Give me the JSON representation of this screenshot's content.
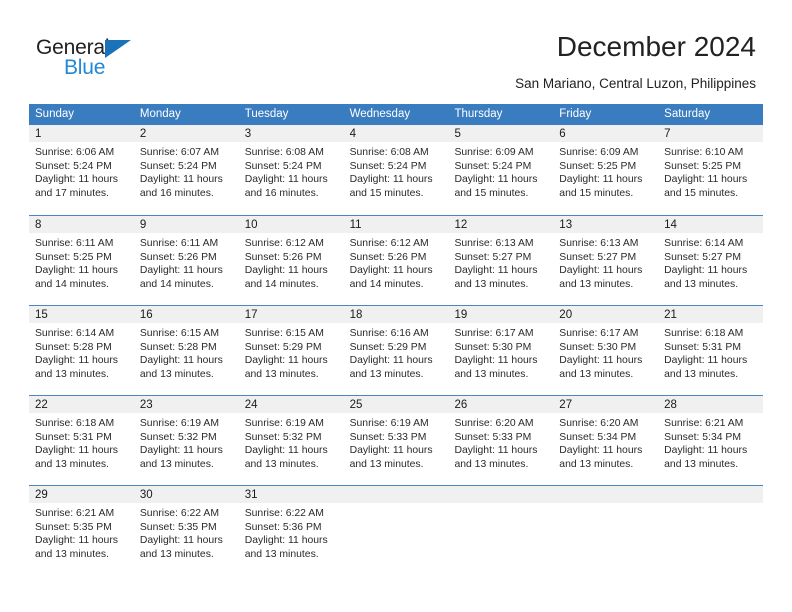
{
  "logo": {
    "word1": "General",
    "word2": "Blue",
    "triangle_color": "#1b72b8",
    "word2_color": "#2288d6"
  },
  "header": {
    "title": "December 2024",
    "subtitle": "San Mariano, Central Luzon, Philippines"
  },
  "calendar": {
    "header_bg": "#3a7cc0",
    "daynum_bg": "#f0f0f0",
    "weekdays": [
      "Sunday",
      "Monday",
      "Tuesday",
      "Wednesday",
      "Thursday",
      "Friday",
      "Saturday"
    ],
    "weeks": [
      [
        {
          "day": "1",
          "sunrise": "Sunrise: 6:06 AM",
          "sunset": "Sunset: 5:24 PM",
          "daylight_line1": "Daylight: 11 hours",
          "daylight_line2": "and 17 minutes."
        },
        {
          "day": "2",
          "sunrise": "Sunrise: 6:07 AM",
          "sunset": "Sunset: 5:24 PM",
          "daylight_line1": "Daylight: 11 hours",
          "daylight_line2": "and 16 minutes."
        },
        {
          "day": "3",
          "sunrise": "Sunrise: 6:08 AM",
          "sunset": "Sunset: 5:24 PM",
          "daylight_line1": "Daylight: 11 hours",
          "daylight_line2": "and 16 minutes."
        },
        {
          "day": "4",
          "sunrise": "Sunrise: 6:08 AM",
          "sunset": "Sunset: 5:24 PM",
          "daylight_line1": "Daylight: 11 hours",
          "daylight_line2": "and 15 minutes."
        },
        {
          "day": "5",
          "sunrise": "Sunrise: 6:09 AM",
          "sunset": "Sunset: 5:24 PM",
          "daylight_line1": "Daylight: 11 hours",
          "daylight_line2": "and 15 minutes."
        },
        {
          "day": "6",
          "sunrise": "Sunrise: 6:09 AM",
          "sunset": "Sunset: 5:25 PM",
          "daylight_line1": "Daylight: 11 hours",
          "daylight_line2": "and 15 minutes."
        },
        {
          "day": "7",
          "sunrise": "Sunrise: 6:10 AM",
          "sunset": "Sunset: 5:25 PM",
          "daylight_line1": "Daylight: 11 hours",
          "daylight_line2": "and 15 minutes."
        }
      ],
      [
        {
          "day": "8",
          "sunrise": "Sunrise: 6:11 AM",
          "sunset": "Sunset: 5:25 PM",
          "daylight_line1": "Daylight: 11 hours",
          "daylight_line2": "and 14 minutes."
        },
        {
          "day": "9",
          "sunrise": "Sunrise: 6:11 AM",
          "sunset": "Sunset: 5:26 PM",
          "daylight_line1": "Daylight: 11 hours",
          "daylight_line2": "and 14 minutes."
        },
        {
          "day": "10",
          "sunrise": "Sunrise: 6:12 AM",
          "sunset": "Sunset: 5:26 PM",
          "daylight_line1": "Daylight: 11 hours",
          "daylight_line2": "and 14 minutes."
        },
        {
          "day": "11",
          "sunrise": "Sunrise: 6:12 AM",
          "sunset": "Sunset: 5:26 PM",
          "daylight_line1": "Daylight: 11 hours",
          "daylight_line2": "and 14 minutes."
        },
        {
          "day": "12",
          "sunrise": "Sunrise: 6:13 AM",
          "sunset": "Sunset: 5:27 PM",
          "daylight_line1": "Daylight: 11 hours",
          "daylight_line2": "and 13 minutes."
        },
        {
          "day": "13",
          "sunrise": "Sunrise: 6:13 AM",
          "sunset": "Sunset: 5:27 PM",
          "daylight_line1": "Daylight: 11 hours",
          "daylight_line2": "and 13 minutes."
        },
        {
          "day": "14",
          "sunrise": "Sunrise: 6:14 AM",
          "sunset": "Sunset: 5:27 PM",
          "daylight_line1": "Daylight: 11 hours",
          "daylight_line2": "and 13 minutes."
        }
      ],
      [
        {
          "day": "15",
          "sunrise": "Sunrise: 6:14 AM",
          "sunset": "Sunset: 5:28 PM",
          "daylight_line1": "Daylight: 11 hours",
          "daylight_line2": "and 13 minutes."
        },
        {
          "day": "16",
          "sunrise": "Sunrise: 6:15 AM",
          "sunset": "Sunset: 5:28 PM",
          "daylight_line1": "Daylight: 11 hours",
          "daylight_line2": "and 13 minutes."
        },
        {
          "day": "17",
          "sunrise": "Sunrise: 6:15 AM",
          "sunset": "Sunset: 5:29 PM",
          "daylight_line1": "Daylight: 11 hours",
          "daylight_line2": "and 13 minutes."
        },
        {
          "day": "18",
          "sunrise": "Sunrise: 6:16 AM",
          "sunset": "Sunset: 5:29 PM",
          "daylight_line1": "Daylight: 11 hours",
          "daylight_line2": "and 13 minutes."
        },
        {
          "day": "19",
          "sunrise": "Sunrise: 6:17 AM",
          "sunset": "Sunset: 5:30 PM",
          "daylight_line1": "Daylight: 11 hours",
          "daylight_line2": "and 13 minutes."
        },
        {
          "day": "20",
          "sunrise": "Sunrise: 6:17 AM",
          "sunset": "Sunset: 5:30 PM",
          "daylight_line1": "Daylight: 11 hours",
          "daylight_line2": "and 13 minutes."
        },
        {
          "day": "21",
          "sunrise": "Sunrise: 6:18 AM",
          "sunset": "Sunset: 5:31 PM",
          "daylight_line1": "Daylight: 11 hours",
          "daylight_line2": "and 13 minutes."
        }
      ],
      [
        {
          "day": "22",
          "sunrise": "Sunrise: 6:18 AM",
          "sunset": "Sunset: 5:31 PM",
          "daylight_line1": "Daylight: 11 hours",
          "daylight_line2": "and 13 minutes."
        },
        {
          "day": "23",
          "sunrise": "Sunrise: 6:19 AM",
          "sunset": "Sunset: 5:32 PM",
          "daylight_line1": "Daylight: 11 hours",
          "daylight_line2": "and 13 minutes."
        },
        {
          "day": "24",
          "sunrise": "Sunrise: 6:19 AM",
          "sunset": "Sunset: 5:32 PM",
          "daylight_line1": "Daylight: 11 hours",
          "daylight_line2": "and 13 minutes."
        },
        {
          "day": "25",
          "sunrise": "Sunrise: 6:19 AM",
          "sunset": "Sunset: 5:33 PM",
          "daylight_line1": "Daylight: 11 hours",
          "daylight_line2": "and 13 minutes."
        },
        {
          "day": "26",
          "sunrise": "Sunrise: 6:20 AM",
          "sunset": "Sunset: 5:33 PM",
          "daylight_line1": "Daylight: 11 hours",
          "daylight_line2": "and 13 minutes."
        },
        {
          "day": "27",
          "sunrise": "Sunrise: 6:20 AM",
          "sunset": "Sunset: 5:34 PM",
          "daylight_line1": "Daylight: 11 hours",
          "daylight_line2": "and 13 minutes."
        },
        {
          "day": "28",
          "sunrise": "Sunrise: 6:21 AM",
          "sunset": "Sunset: 5:34 PM",
          "daylight_line1": "Daylight: 11 hours",
          "daylight_line2": "and 13 minutes."
        }
      ],
      [
        {
          "day": "29",
          "sunrise": "Sunrise: 6:21 AM",
          "sunset": "Sunset: 5:35 PM",
          "daylight_line1": "Daylight: 11 hours",
          "daylight_line2": "and 13 minutes."
        },
        {
          "day": "30",
          "sunrise": "Sunrise: 6:22 AM",
          "sunset": "Sunset: 5:35 PM",
          "daylight_line1": "Daylight: 11 hours",
          "daylight_line2": "and 13 minutes."
        },
        {
          "day": "31",
          "sunrise": "Sunrise: 6:22 AM",
          "sunset": "Sunset: 5:36 PM",
          "daylight_line1": "Daylight: 11 hours",
          "daylight_line2": "and 13 minutes."
        },
        {
          "day": "",
          "sunrise": "",
          "sunset": "",
          "daylight_line1": "",
          "daylight_line2": ""
        },
        {
          "day": "",
          "sunrise": "",
          "sunset": "",
          "daylight_line1": "",
          "daylight_line2": ""
        },
        {
          "day": "",
          "sunrise": "",
          "sunset": "",
          "daylight_line1": "",
          "daylight_line2": ""
        },
        {
          "day": "",
          "sunrise": "",
          "sunset": "",
          "daylight_line1": "",
          "daylight_line2": ""
        }
      ]
    ]
  }
}
